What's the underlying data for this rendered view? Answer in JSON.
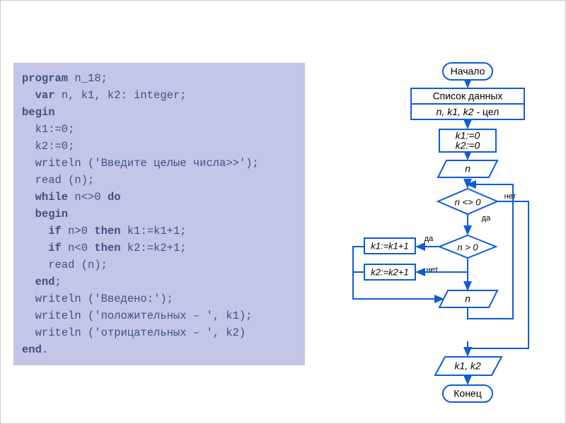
{
  "code": {
    "l1a": "program",
    "l1b": " n_18;",
    "l2a": "  var",
    "l2b": " n, k1, k2: integer;",
    "l3": "begin",
    "l4": "  k1:=0;",
    "l5": "  k2:=0;",
    "l6": "  writeln ('Введите целые числа>>');",
    "l7": "  read (n);",
    "l8a": "  while",
    "l8b": " n<>0 ",
    "l8c": "do",
    "l9": "  begin",
    "l10a": "    if",
    "l10b": " n>0 ",
    "l10c": "then",
    "l10d": " k1:=k1+1;",
    "l11a": "    if",
    "l11b": " n<0 ",
    "l11c": "then",
    "l11d": " k2:=k2+1;",
    "l12": "    read (n);",
    "l13a": "  end",
    "l13b": ";",
    "l14": "  writeln ('Введено:');",
    "l15": "  writeln ('положительных – ', k1);",
    "l16": "  writeln ('отрицательных – ', k2)",
    "l17a": "end",
    "l17b": "."
  },
  "fc": {
    "start": "Начало",
    "datalist": "Список данных",
    "vars": "n, k1, k2",
    "vars_suffix": " - цел",
    "init1": "k1:=0",
    "init2": "k2:=0",
    "read_n": "n",
    "cond1": "n <> 0",
    "cond2": "n > 0",
    "assign1": "k1:=k1+1",
    "assign2": "k2:=k2+1",
    "read_n2": "n",
    "out": "k1, k2",
    "end": "Конец",
    "yes": "да",
    "no": "нет"
  }
}
